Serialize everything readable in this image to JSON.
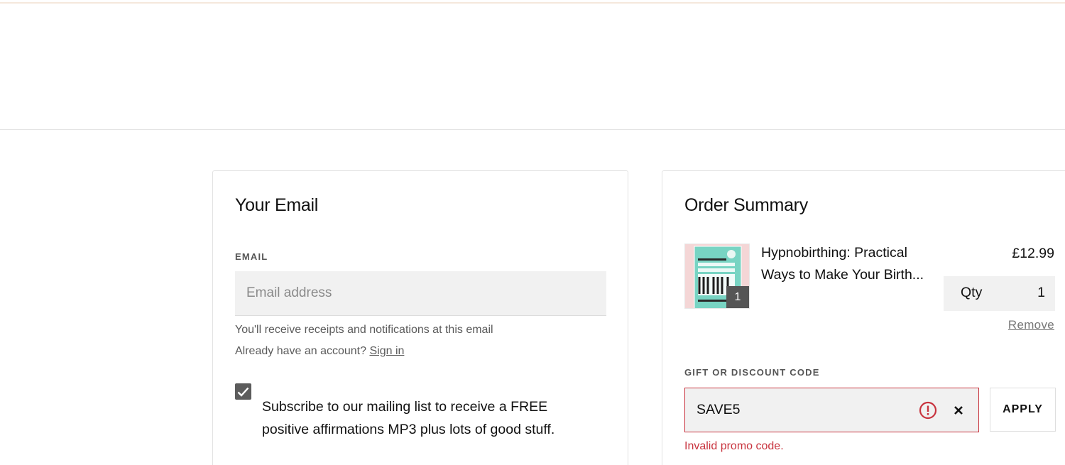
{
  "colors": {
    "accent_line": "#f5e8dc",
    "error": "#c8333e",
    "input_bg": "#f1f1f1",
    "checkbox": "#5c5c5c"
  },
  "email_section": {
    "title": "Your Email",
    "email_label": "EMAIL",
    "email_value": "",
    "email_placeholder": "Email address",
    "hint_receipts": "You'll receive receipts and notifications at this email",
    "account_prompt": "Already have an account?",
    "sign_in_label": "Sign in",
    "subscribe_checked": true,
    "subscribe_text": "Subscribe to our mailing list to receive a FREE positive affirmations MP3 plus lots of good stuff."
  },
  "order_summary": {
    "title": "Order Summary",
    "items": [
      {
        "name": "Hypnobirthing: Practical Ways to Make Your Birth...",
        "price": "£12.99",
        "quantity_badge": "1",
        "qty_label": "Qty",
        "qty_value": "1",
        "remove_label": "Remove",
        "thumbnail_icon": "book-cover-thumbnail"
      }
    ],
    "discount": {
      "label": "GIFT OR DISCOUNT CODE",
      "value": "SAVE5",
      "apply_label": "APPLY",
      "error_message": "Invalid promo code.",
      "error_icon": "alert-circle-icon",
      "clear_icon": "close-icon"
    }
  }
}
